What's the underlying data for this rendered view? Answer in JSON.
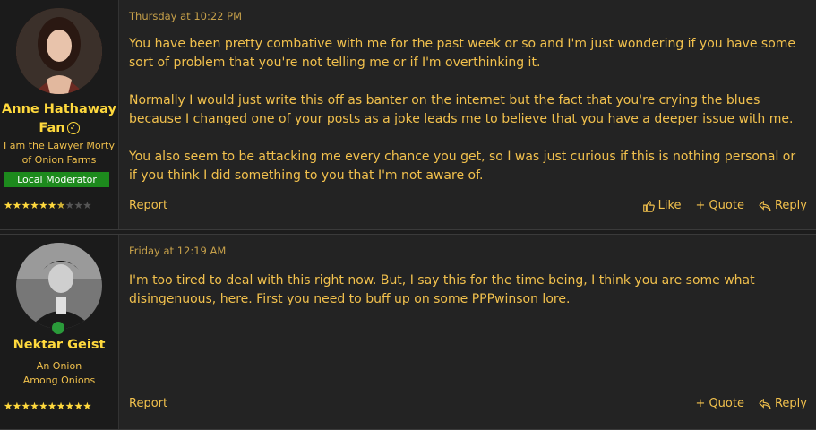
{
  "posts": [
    {
      "user": {
        "name": "Anne Hathaway Fan",
        "title": "I am the Lawyer Morty of Onion Farms",
        "badge": "Local Moderator",
        "stars_filled": 7,
        "stars_total": 10
      },
      "date": "Thursday at 10:22 PM",
      "paragraphs": [
        "You have been pretty combative with me for the past week or so and I'm just wondering if you have some sort of problem that you're not telling me or if I'm overthinking it.",
        "Normally I would just write this off as banter on the internet but the fact that you're crying the blues because I changed one of your posts as a joke leads me to believe that you have a deeper issue with me.",
        "You also seem to be attacking me every chance you get, so I was just curious if this is nothing personal or if you think I did something to you that I'm not aware of."
      ],
      "actions": {
        "report": "Report",
        "like": "Like",
        "quote": "Quote",
        "reply": "Reply"
      }
    },
    {
      "user": {
        "name": "Nektar Geist",
        "title": "An Onion Among Onions",
        "stars_filled": 10,
        "stars_total": 10
      },
      "date": "Friday at 12:19 AM",
      "paragraphs": [
        "I'm too tired to deal with this right now. But, I say this for the time being, I think you are some what disingenuous, here. First you need to buff up on some PPPwinson lore."
      ],
      "actions": {
        "report": "Report",
        "quote": "Quote",
        "reply": "Reply"
      }
    }
  ],
  "icons": {
    "like": "thumbs-up-icon",
    "quote": "plus-icon",
    "reply": "reply-arrow-icon",
    "verified": "check-circle-icon"
  }
}
